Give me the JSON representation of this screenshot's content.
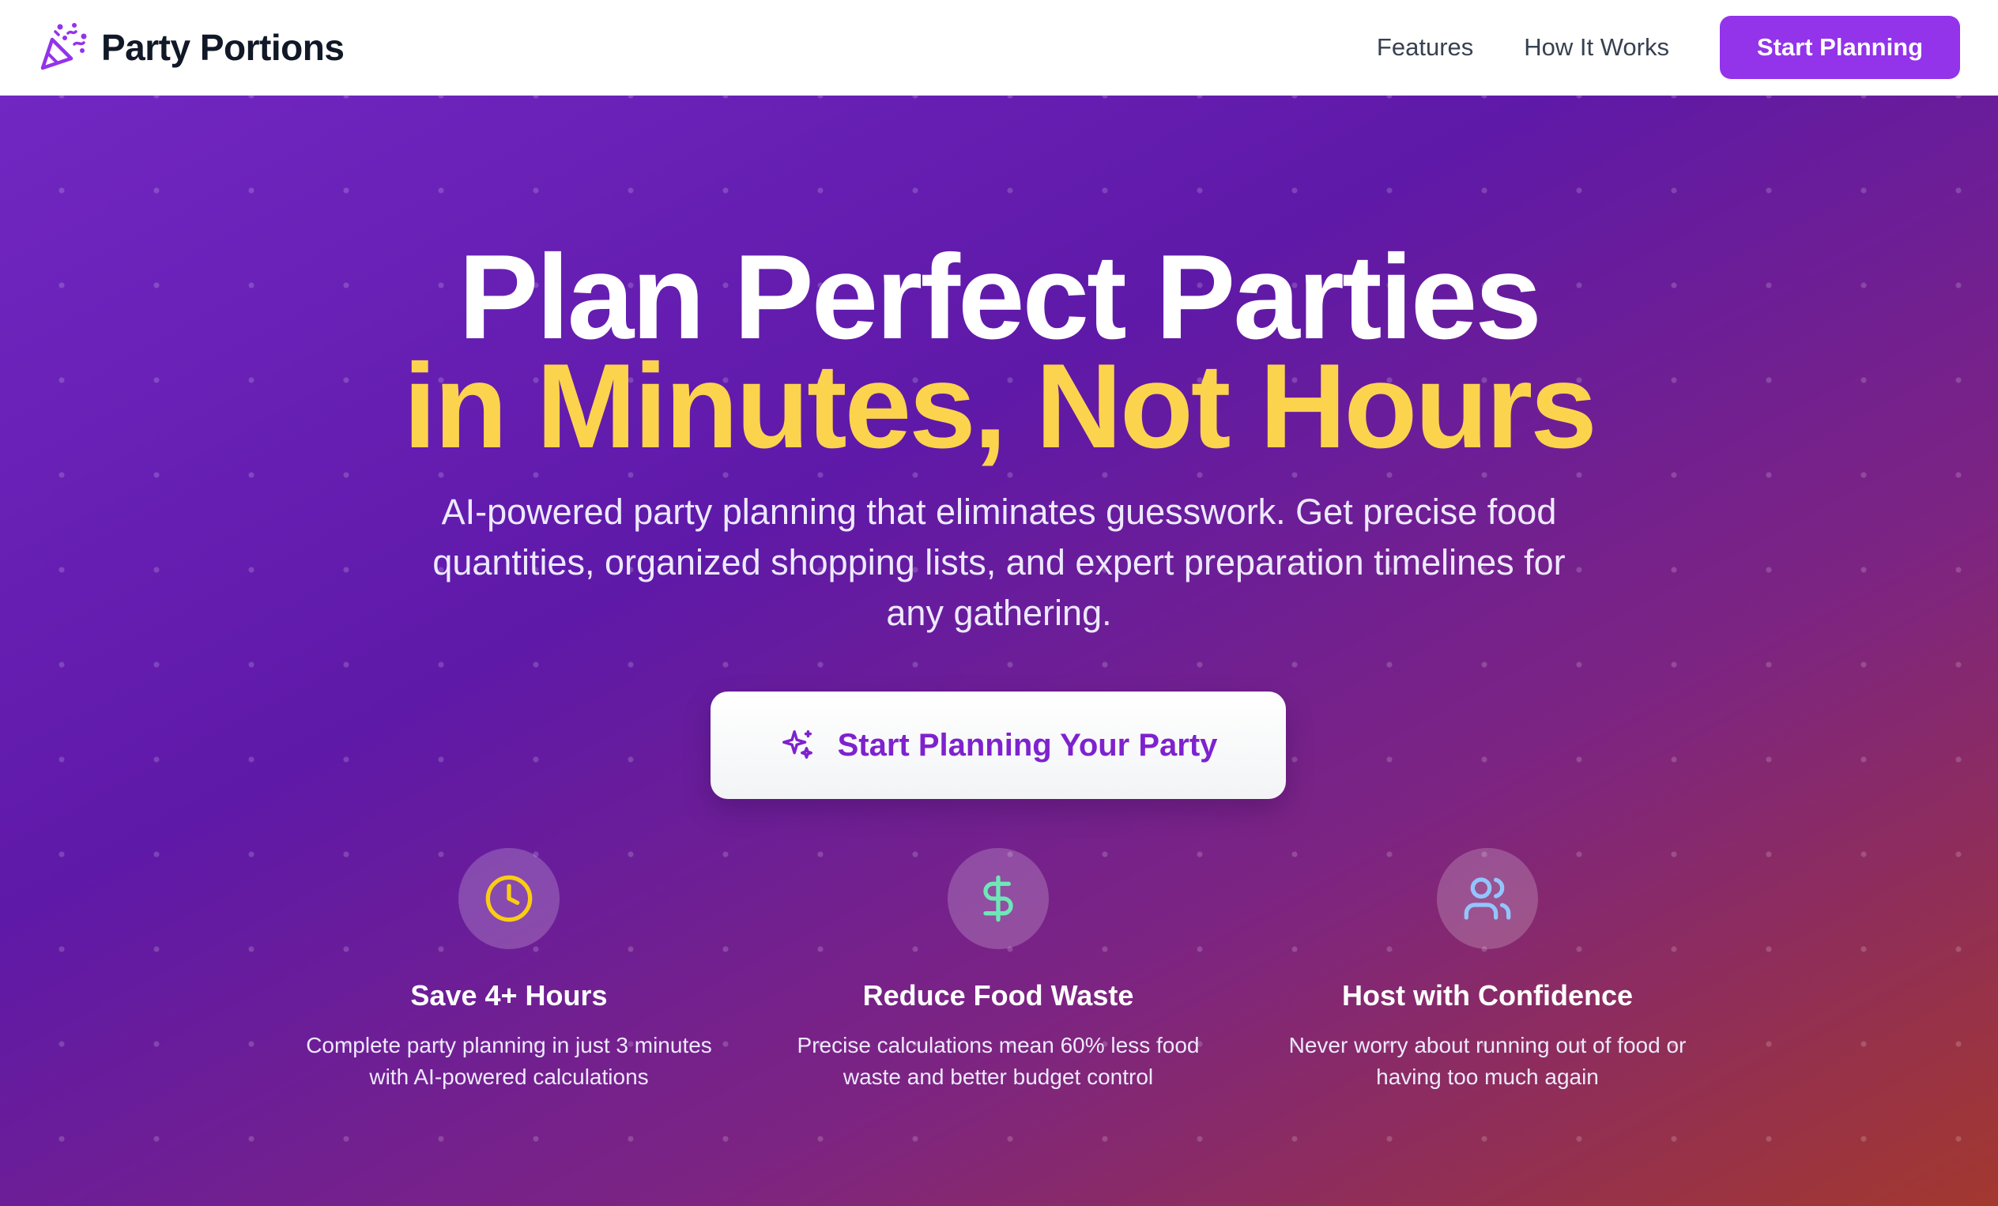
{
  "nav": {
    "brand": "Party Portions",
    "links": [
      "Features",
      "How It Works"
    ],
    "cta_label": "Start Planning"
  },
  "hero": {
    "title_line1": "Plan Perfect Parties",
    "title_line2": "in Minutes, Not Hours",
    "subtitle": "AI-powered party planning that eliminates guesswork. Get precise food quantities, organized shopping lists, and expert preparation timelines for any gathering.",
    "cta_label": "Start Planning Your Party",
    "cta_icon": "sparkles-icon"
  },
  "features": [
    {
      "icon": "clock-icon",
      "icon_color": "#facc15",
      "title": "Save 4+ Hours",
      "description": "Complete party planning in just 3 minutes with AI-powered calculations"
    },
    {
      "icon": "dollar-icon",
      "icon_color": "#6ee7b7",
      "title": "Reduce Food Waste",
      "description": "Precise calculations mean 60% less food waste and better budget control"
    },
    {
      "icon": "users-icon",
      "icon_color": "#93c5fd",
      "title": "Host with Confidence",
      "description": "Never worry about running out of food or having too much again"
    }
  ],
  "colors": {
    "brand_purple": "#9333ea",
    "headline_yellow": "#fcd34d",
    "cta_text": "#7e22ce"
  }
}
